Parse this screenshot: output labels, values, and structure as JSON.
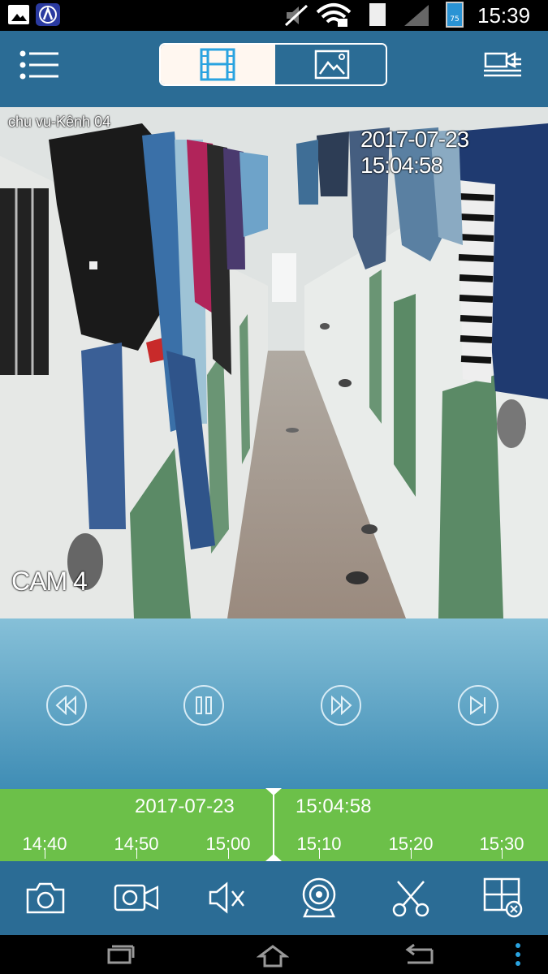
{
  "status_bar": {
    "time": "15:39",
    "battery_level": "75",
    "icons": [
      "image-notification-icon",
      "app-notification-icon",
      "mute-icon",
      "wifi-icon",
      "sim-icon",
      "signal-icon",
      "battery-icon"
    ]
  },
  "header": {
    "menu_icon": "menu-icon",
    "tabs": [
      {
        "name": "video-playback-tab",
        "icon": "film-icon",
        "selected": true
      },
      {
        "name": "image-tab",
        "icon": "picture-icon",
        "selected": false
      }
    ],
    "right_icon": "recording-list-icon"
  },
  "video": {
    "channel_label": "chu vu-Kênh 04",
    "timestamp_overlay": "2017-07-23 15:04:58",
    "camera_label": "CAM 4"
  },
  "playback_controls": [
    {
      "name": "rewind-button",
      "icon": "rewind-icon"
    },
    {
      "name": "pause-button",
      "icon": "pause-icon"
    },
    {
      "name": "fast-forward-button",
      "icon": "fast-forward-icon"
    },
    {
      "name": "next-frame-button",
      "icon": "next-frame-icon"
    }
  ],
  "timeline": {
    "date": "2017-07-23",
    "time": "15:04:58",
    "ticks": [
      "14:40",
      "14:50",
      "15:00",
      "15:10",
      "15:20",
      "15:30"
    ]
  },
  "toolbar": [
    {
      "name": "snapshot-button",
      "icon": "camera-icon"
    },
    {
      "name": "record-button",
      "icon": "video-camera-icon"
    },
    {
      "name": "mute-button",
      "icon": "speaker-mute-icon"
    },
    {
      "name": "stream-button",
      "icon": "webcam-icon"
    },
    {
      "name": "clip-button",
      "icon": "scissors-icon"
    },
    {
      "name": "close-window-button",
      "icon": "grid-close-icon"
    }
  ],
  "colors": {
    "header_bg": "#2b6c95",
    "timeline_bg": "#6cc049",
    "selected_tab_bg": "#fff7f0",
    "accent_icon": "#2aa3e0"
  }
}
